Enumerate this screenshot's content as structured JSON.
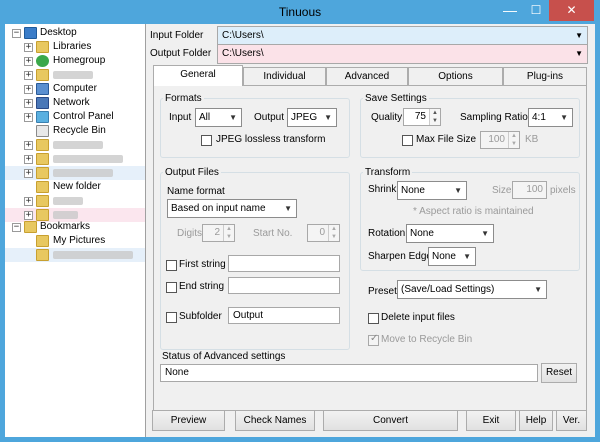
{
  "window": {
    "title": "Tinuous",
    "minimize": "—",
    "maximize": "☐",
    "close": "✕"
  },
  "tree": {
    "desktop": "Desktop",
    "libraries": "Libraries",
    "homegroup": "Homegroup",
    "computer": "Computer",
    "network": "Network",
    "control_panel": "Control Panel",
    "recycle_bin": "Recycle Bin",
    "new_folder": "New folder",
    "bookmarks": "Bookmarks",
    "my_pictures": "My Pictures"
  },
  "folders": {
    "input_label": "Input Folder",
    "input_value": "C:\\Users\\",
    "output_label": "Output Folder",
    "output_value": "C:\\Users\\"
  },
  "tabs": [
    "General",
    "Individual",
    "Advanced",
    "Options",
    "Plug-ins"
  ],
  "formats": {
    "title": "Formats",
    "input_label": "Input",
    "input_value": "All",
    "output_label": "Output",
    "output_value": "JPEG",
    "lossless_label": "JPEG lossless transform"
  },
  "save": {
    "title": "Save Settings",
    "quality_label": "Quality",
    "quality_value": "75",
    "sampling_label": "Sampling Ratio",
    "sampling_value": "4:1",
    "maxsize_label": "Max File Size",
    "maxsize_value": "100",
    "maxsize_unit": "KB"
  },
  "output_files": {
    "title": "Output Files",
    "name_format_label": "Name format",
    "name_format_value": "Based on input name",
    "digits_label": "Digits",
    "digits_value": "2",
    "start_label": "Start No.",
    "start_value": "0",
    "first_string_label": "First string",
    "end_string_label": "End string",
    "subfolder_label": "Subfolder",
    "subfolder_value": "Output"
  },
  "transform": {
    "title": "Transform",
    "shrink_label": "Shrink",
    "shrink_value": "None",
    "size_label": "Size",
    "size_value": "100",
    "size_unit": "pixels",
    "aspect_note": "* Aspect ratio is maintained",
    "rotation_label": "Rotation",
    "rotation_value": "None",
    "sharpen_label": "Sharpen Edge",
    "sharpen_value": "None"
  },
  "preset": {
    "label": "Preset",
    "value": "(Save/Load Settings)",
    "delete_label": "Delete input files",
    "recycle_label": "Move to Recycle Bin"
  },
  "status": {
    "label": "Status of Advanced settings",
    "value": "None",
    "reset": "Reset"
  },
  "buttons": {
    "preview": "Preview",
    "check_names": "Check Names",
    "convert": "Convert",
    "exit": "Exit",
    "help": "Help",
    "ver": "Ver."
  },
  "colors": {
    "title_bar": "#4ea6dc",
    "close_button": "#c7504c",
    "input_field": "#ddeefa",
    "output_field": "#fbe2e8"
  }
}
